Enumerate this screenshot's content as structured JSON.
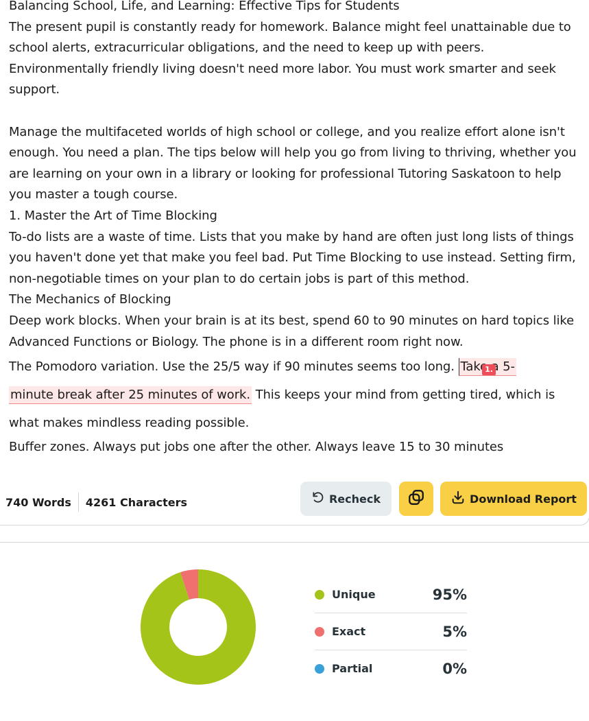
{
  "document": {
    "title": "Balancing School, Life, and Learning: Effective Tips for Students",
    "para1": "The present pupil is constantly ready for homework. Balance might feel unattainable due to school alerts, extracurricular obligations, and the need to keep up with peers. Environmentally friendly living doesn't need more labor. You must work smarter and seek support.",
    "para2": "Manage the multifaceted worlds of high school or college, and you realize effort alone isn't enough. You need a plan. The tips below will help you go from living to thriving, whether you are learning on your own in a library or looking for professional Tutoring Saskatoon to help you master a tough course.",
    "heading1": "1. Master the Art of Time Blocking",
    "para3": "To-do lists are a waste of time. Lists that you make by hand are often just long lists of things you haven't done yet that make you feel bad. Put Time Blocking to use instead. Setting firm, non-negotiable times on your plan to do certain jobs is part of this method.",
    "heading2": "The Mechanics of Blocking",
    "para4": "Deep work blocks. When your brain is at its best, spend 60 to 90 minutes on hard topics like Advanced Functions or Biology. The phone is in a different room right now.",
    "para5_before": "The Pomodoro variation. Use the 25/5 way if 90 minutes seems too long. ",
    "para5_match_line1": "Take a 5-",
    "para5_match_line2": "minute break after 25 minutes of work.",
    "para5_after": " This keeps your mind from getting tired, which is what makes mindless reading possible.",
    "para6": "Buffer zones. Always put jobs one after the other. Always leave 15 to 30 minutes",
    "match_badge": "1."
  },
  "toolbar": {
    "words": "740 Words",
    "characters": "4261 Characters",
    "recheck_label": "Recheck",
    "download_label": "Download Report"
  },
  "results": {
    "items": [
      {
        "label": "Unique",
        "value": "95%",
        "color": "#a5c41a"
      },
      {
        "label": "Exact",
        "value": "5%",
        "color": "#f07070"
      },
      {
        "label": "Partial",
        "value": "0%",
        "color": "#3aa0d8"
      }
    ]
  },
  "chart_data": {
    "type": "pie",
    "categories": [
      "Unique",
      "Exact",
      "Partial"
    ],
    "values": [
      95,
      5,
      0
    ],
    "colors": [
      "#a5c41a",
      "#f07070",
      "#3aa0d8"
    ]
  }
}
